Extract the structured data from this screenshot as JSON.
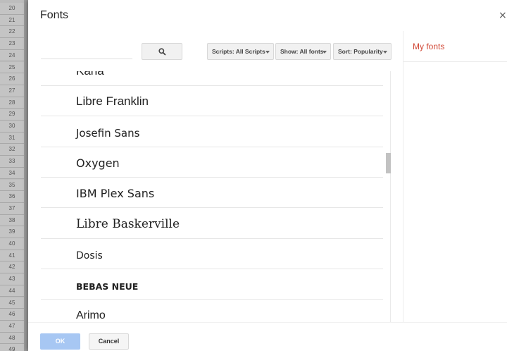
{
  "sheet": {
    "row_numbers": [
      "20",
      "21",
      "22",
      "23",
      "24",
      "25",
      "26",
      "27",
      "28",
      "29",
      "30",
      "31",
      "32",
      "33",
      "34",
      "35",
      "36",
      "37",
      "38",
      "39",
      "40",
      "41",
      "42",
      "43",
      "44",
      "45",
      "46",
      "47",
      "48",
      "49"
    ]
  },
  "dialog": {
    "title": "Fonts",
    "close_label": "×"
  },
  "search": {
    "placeholder": "",
    "value": "",
    "button_icon": "search-icon"
  },
  "filters": {
    "scripts_label": "Scripts: All Scripts",
    "show_label": "Show: All fonts",
    "sort_label": "Sort: Popularity"
  },
  "font_list": [
    {
      "name": "Karla",
      "family": "\"Liberation Sans\", sans-serif",
      "size": "17px",
      "weight": "normal"
    },
    {
      "name": "Libre Franklin",
      "family": "\"Liberation Sans\", sans-serif",
      "size": "17px",
      "weight": "normal"
    },
    {
      "name": "Josefin Sans",
      "family": "\"DejaVu Sans\", sans-serif",
      "size": "15px",
      "weight": "normal"
    },
    {
      "name": "Oxygen",
      "family": "\"DejaVu Sans\", sans-serif",
      "size": "16px",
      "weight": "normal"
    },
    {
      "name": "IBM Plex Sans",
      "family": "\"DejaVu Sans\", sans-serif",
      "size": "16px",
      "weight": "normal"
    },
    {
      "name": "Libre Baskerville",
      "family": "\"DejaVu Serif\", serif",
      "size": "17px",
      "weight": "normal"
    },
    {
      "name": "Dosis",
      "family": "\"DejaVu Sans\", sans-serif",
      "size": "14px",
      "weight": "normal"
    },
    {
      "name": "BEBAS NEUE",
      "family": "\"DejaVu Sans\", sans-serif",
      "size": "12.5px",
      "weight": "bold"
    },
    {
      "name": "Arimo",
      "family": "\"Liberation Sans\", sans-serif",
      "size": "16px",
      "weight": "normal"
    }
  ],
  "my_fonts": {
    "title": "My fonts"
  },
  "footer": {
    "ok_label": "OK",
    "cancel_label": "Cancel"
  },
  "colors": {
    "accent_red": "#d14836",
    "ok_blue": "#a7c7f3"
  }
}
